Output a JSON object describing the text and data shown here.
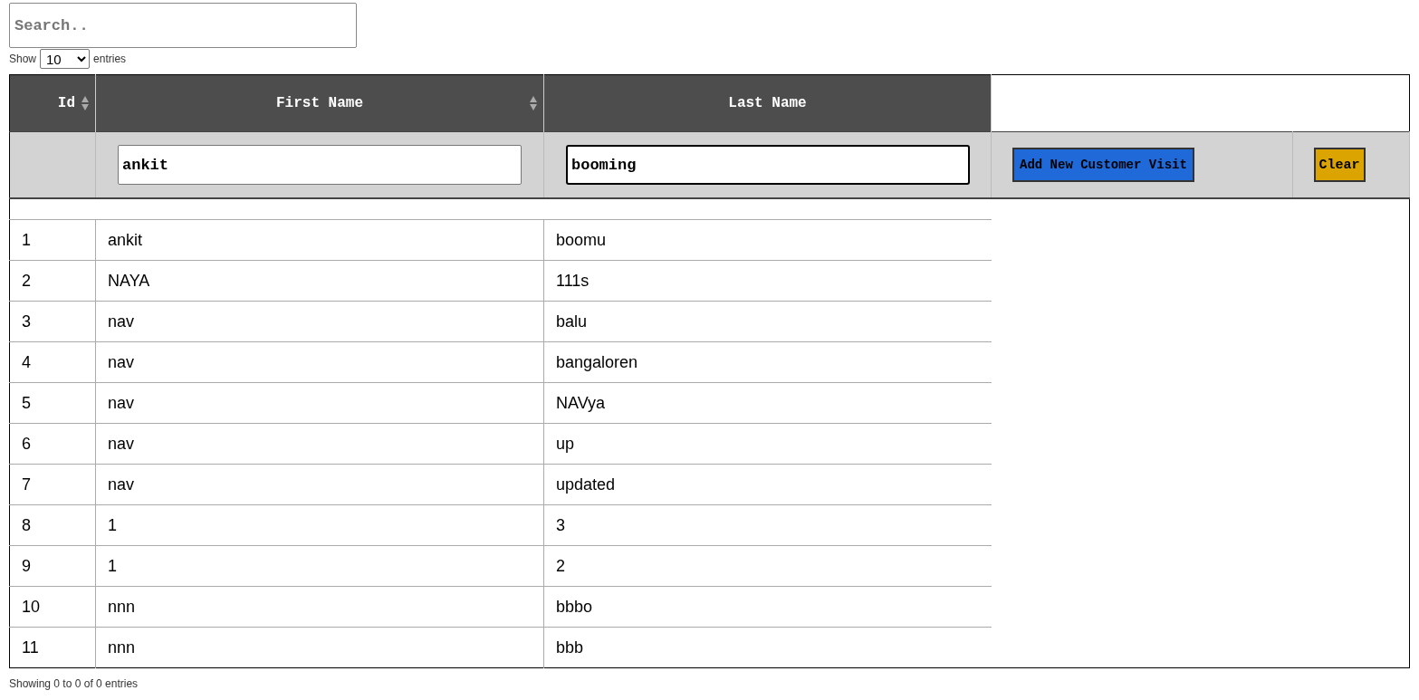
{
  "search": {
    "placeholder": "Search.."
  },
  "length_menu": {
    "label_before": "Show",
    "value": "10",
    "label_after": "entries"
  },
  "table": {
    "columns": [
      {
        "label": "Id",
        "sortable": true
      },
      {
        "label": "First Name",
        "sortable": true
      },
      {
        "label": "Last Name",
        "sortable": false
      }
    ],
    "filters": {
      "first_name": "ankit",
      "last_name": "booming",
      "add_button": "Add New Customer Visit",
      "clear_button": "Clear"
    },
    "rows": [
      {
        "id": "1",
        "first_name": "ankit",
        "last_name": "boomu"
      },
      {
        "id": "2",
        "first_name": "NAYA",
        "last_name": "111s"
      },
      {
        "id": "3",
        "first_name": "nav",
        "last_name": "balu"
      },
      {
        "id": "4",
        "first_name": "nav",
        "last_name": "bangaloren"
      },
      {
        "id": "5",
        "first_name": "nav",
        "last_name": "NAVya"
      },
      {
        "id": "6",
        "first_name": "nav",
        "last_name": "up"
      },
      {
        "id": "7",
        "first_name": "nav",
        "last_name": "updated"
      },
      {
        "id": "8",
        "first_name": "1",
        "last_name": "3"
      },
      {
        "id": "9",
        "first_name": "1",
        "last_name": "2"
      },
      {
        "id": "10",
        "first_name": "nnn",
        "last_name": "bbbo"
      },
      {
        "id": "11",
        "first_name": "nnn",
        "last_name": "bbb"
      }
    ]
  },
  "info": "Showing 0 to 0 of 0 entries"
}
